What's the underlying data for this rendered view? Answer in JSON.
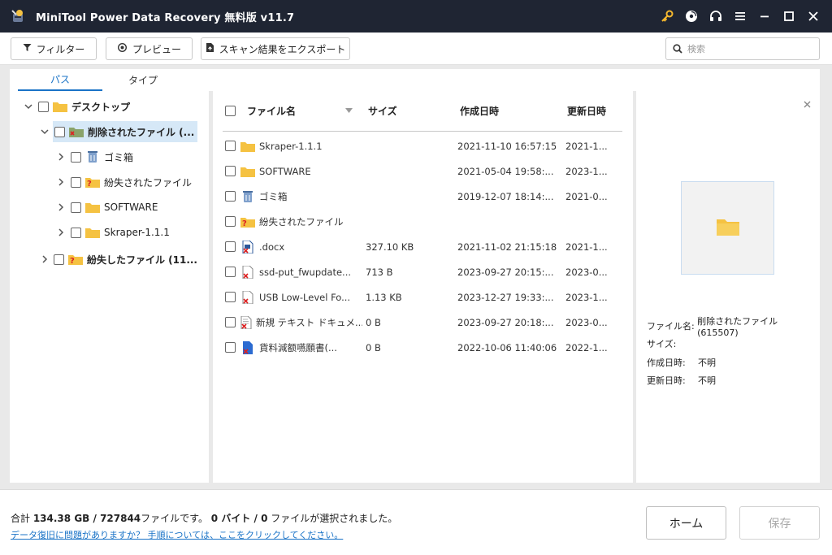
{
  "window": {
    "title": "MiniTool Power Data Recovery 無料版 v11.7",
    "controls": [
      "key-icon",
      "disc-icon",
      "headset-icon",
      "menu-icon",
      "minimize-icon",
      "maximize-icon",
      "close-icon"
    ]
  },
  "toolbar": {
    "filter_label": "フィルター",
    "preview_label": "プレビュー",
    "export_label": "スキャン結果をエクスポート",
    "search_placeholder": "検索"
  },
  "tabs": {
    "path": "パス",
    "type": "タイプ",
    "active": "path"
  },
  "tree": [
    {
      "label": "デスクトップ",
      "level": 0,
      "expanded": true,
      "bold": true,
      "icon": "folder-icon"
    },
    {
      "label": "削除されたファイル (...",
      "level": 1,
      "expanded": true,
      "bold": true,
      "selected": true,
      "icon": "deleted-folder-icon"
    },
    {
      "label": "ゴミ箱",
      "level": 2,
      "expanded": false,
      "icon": "recycle-bin-icon"
    },
    {
      "label": "紛失されたファイル",
      "level": 2,
      "expanded": false,
      "icon": "lost-folder-icon"
    },
    {
      "label": "SOFTWARE",
      "level": 2,
      "expanded": false,
      "icon": "folder-icon"
    },
    {
      "label": "Skraper-1.1.1",
      "level": 2,
      "expanded": false,
      "icon": "folder-icon"
    },
    {
      "label": "紛失したファイル (11...",
      "level": 1,
      "expanded": false,
      "bold": true,
      "icon": "lost-folder-icon"
    }
  ],
  "file_list": {
    "columns": {
      "name": "ファイル名",
      "size": "サイズ",
      "created": "作成日時",
      "modified": "更新日時"
    },
    "rows": [
      {
        "name": "Skraper-1.1.1",
        "size": "",
        "created": "2021-11-10 16:57:15",
        "modified": "2021-1...",
        "icon": "folder-icon"
      },
      {
        "name": "SOFTWARE",
        "size": "",
        "created": "2021-05-04 19:58:...",
        "modified": "2023-1...",
        "icon": "folder-icon"
      },
      {
        "name": "ゴミ箱",
        "size": "",
        "created": "2019-12-07 18:14:...",
        "modified": "2021-0...",
        "icon": "recycle-bin-icon"
      },
      {
        "name": "紛失されたファイル",
        "size": "",
        "created": "",
        "modified": "",
        "icon": "lost-folder-icon"
      },
      {
        "name": ".docx",
        "size": "327.10 KB",
        "created": "2021-11-02 21:15:18",
        "modified": "2021-1...",
        "icon": "deleted-word-icon"
      },
      {
        "name": "ssd-put_fwupdate...",
        "size": "713 B",
        "created": "2023-09-27 20:15:...",
        "modified": "2023-0...",
        "icon": "deleted-file-icon"
      },
      {
        "name": "USB Low-Level Fo...",
        "size": "1.13 KB",
        "created": "2023-12-27 19:33:...",
        "modified": "2023-1...",
        "icon": "deleted-file-icon"
      },
      {
        "name": "新規 テキスト ドキュメ...",
        "size": "0 B",
        "created": "2023-09-27 20:18:...",
        "modified": "2023-0...",
        "icon": "deleted-text-icon"
      },
      {
        "name": "貨料減额嚥願書(...",
        "size": "0 B",
        "created": "2022-10-06 11:40:06",
        "modified": "2022-1...",
        "icon": "deleted-doc-icon"
      }
    ]
  },
  "preview": {
    "name_label": "ファイル名:",
    "name_value": "削除されたファイル (615507)",
    "size_label": "サイズ:",
    "size_value": "",
    "created_label": "作成日時:",
    "created_value": "不明",
    "modified_label": "更新日時:",
    "modified_value": "不明"
  },
  "status": {
    "prefix": "合計 ",
    "total_size": "134.38 GB",
    "sep1": " / ",
    "total_files": "727844",
    "files_suffix": "ファイルです。 ",
    "selected_bytes": "0 バイト",
    "sep2": " / ",
    "selected_files": "0",
    "selected_suffix": " ファイルが選択されました。",
    "help_link": "データ復旧に問題がありますか？ 手順については、ここをクリックしてください。"
  },
  "buttons": {
    "home": "ホーム",
    "save": "保存"
  },
  "colors": {
    "titlebar": "#1f2533",
    "accent": "#1a73c7",
    "folder": "#f5c242",
    "selected_row": "#d6e8f7"
  }
}
